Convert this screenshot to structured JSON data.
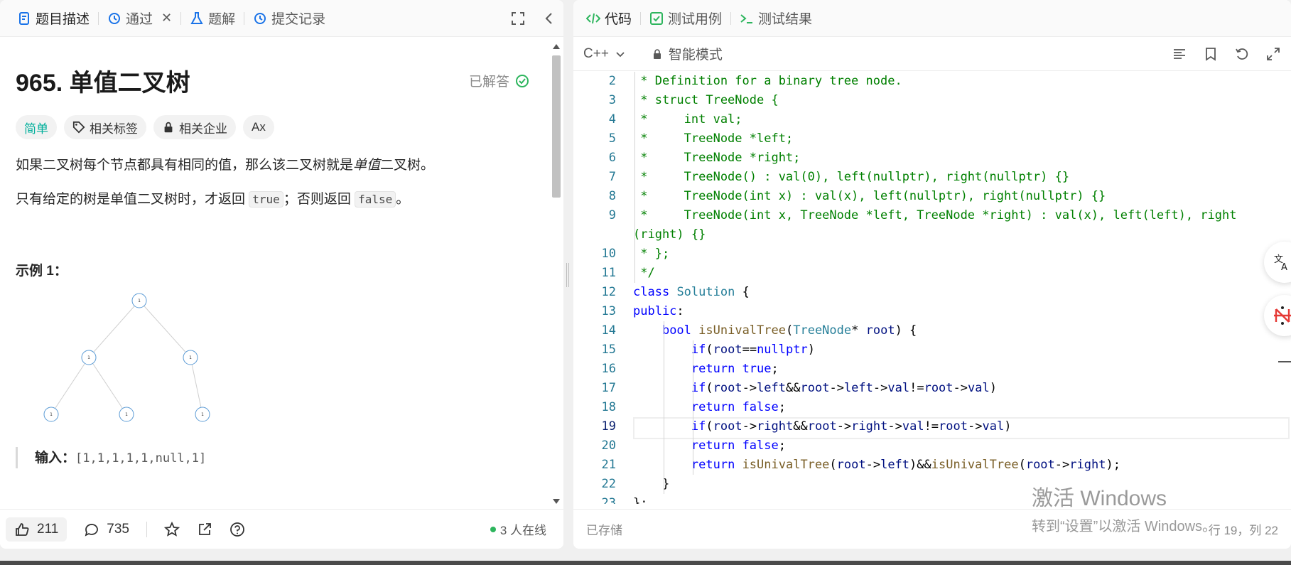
{
  "left": {
    "tabs": [
      {
        "label": "题目描述",
        "icon": "description-icon",
        "active": true
      },
      {
        "label": "通过",
        "icon": "history-icon",
        "closable": true
      },
      {
        "label": "题解",
        "icon": "flask-icon"
      },
      {
        "label": "提交记录",
        "icon": "history-icon"
      }
    ],
    "close_glyph": "✕",
    "title": "965. 单值二叉树",
    "solved_label": "已解答",
    "tags": {
      "difficulty": "简单",
      "related_tags": "相关标签",
      "related_companies": "相关企业",
      "font_icon": "Ax"
    },
    "desc_p1_a": "如果二叉树每个节点都具有相同的值，那么该二叉树就是",
    "desc_p1_em": "单值",
    "desc_p1_b": "二叉树。",
    "desc_p2_a": "只有给定的树是单值二叉树时，才返回 ",
    "desc_p2_code1": "true",
    "desc_p2_b": "；否则返回 ",
    "desc_p2_code2": "false",
    "desc_p2_c": "。",
    "example_title": "示例 1：",
    "tree_node_label": "1",
    "input_label": "输入：",
    "input_value": "[1,1,1,1,1,null,1]",
    "footer": {
      "likes": "211",
      "comments": "735",
      "online_text": "3 人在线"
    }
  },
  "right": {
    "tabs": [
      {
        "label": "代码",
        "icon": "code-icon",
        "active": true
      },
      {
        "label": "测试用例",
        "icon": "checkbox-icon"
      },
      {
        "label": "测试结果",
        "icon": "terminal-icon"
      }
    ],
    "language": "C++",
    "mode": "智能模式",
    "current_line": "19",
    "footer": {
      "saved": "已存储",
      "cursor": "行 19，列 22"
    }
  },
  "watermark": {
    "line1": "激活 Windows",
    "line2": "转到“设置”以激活 Windows。"
  },
  "colors": {
    "accent_green": "#2db55d",
    "easy_teal": "#00af9b",
    "comment_green": "#008000",
    "keyword_blue": "#0000ff"
  }
}
